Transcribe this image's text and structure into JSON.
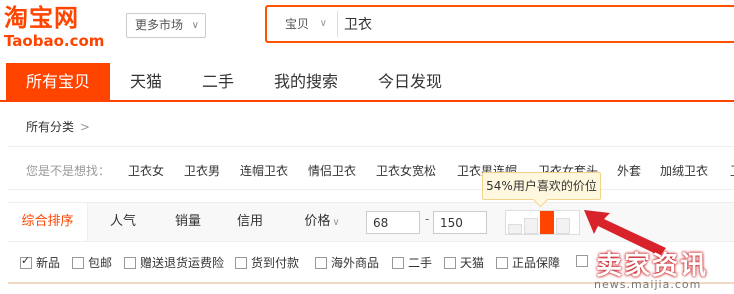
{
  "header": {
    "logo_cn": "淘宝网",
    "logo_en": "Taobao.com",
    "market_select": "更多市场",
    "search": {
      "category": "宝贝",
      "query": "卫衣"
    }
  },
  "nav": {
    "items": [
      {
        "label": "所有宝贝",
        "active": true
      },
      {
        "label": "天猫"
      },
      {
        "label": "二手"
      },
      {
        "label": "我的搜索"
      },
      {
        "label": "今日发现"
      }
    ]
  },
  "breadcrumb": {
    "label": "所有分类",
    "arrow": ">"
  },
  "related": {
    "label": "您是不是想找：",
    "items": [
      "卫衣女",
      "卫衣男",
      "连帽卫衣",
      "情侣卫衣",
      "卫衣女宽松",
      "卫衣男连帽",
      "卫衣女套头",
      "外套",
      "加绒卫衣",
      "卫"
    ]
  },
  "sort": {
    "items": [
      "综合排序",
      "人气",
      "销量",
      "信用",
      "价格"
    ],
    "price_min": "68",
    "price_dash": "-",
    "price_max": "150",
    "price_range_preference_percent": 54,
    "price_bars_active_index": 2
  },
  "tooltip": "54%用户喜欢的价位",
  "filters": {
    "items": [
      {
        "label": "新品",
        "checked": true
      },
      {
        "label": "包邮"
      },
      {
        "label": "赠送退货运费险"
      },
      {
        "label": "货到付款"
      },
      {
        "label": "海外商品"
      },
      {
        "label": "二手"
      },
      {
        "label": "天猫"
      },
      {
        "label": "正品保障"
      },
      {
        "label": ""
      }
    ]
  },
  "watermark": {
    "cn": "卖家资讯",
    "en": "news.maijia.com"
  },
  "colors": {
    "brand": "#ff4400",
    "tooltip_bg": "#fff8df",
    "annotation": "#d8232a"
  }
}
